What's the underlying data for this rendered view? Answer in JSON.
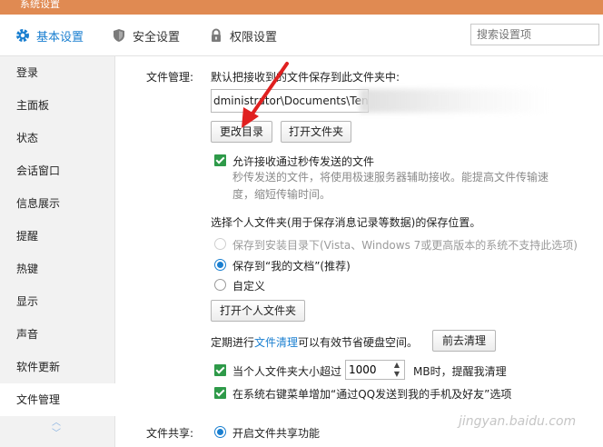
{
  "window": {
    "title": "系统设置"
  },
  "tabs": [
    {
      "label": "基本设置",
      "icon": "gear-icon",
      "active": true
    },
    {
      "label": "安全设置",
      "icon": "shield-icon",
      "active": false
    },
    {
      "label": "权限设置",
      "icon": "lock-icon",
      "active": false
    }
  ],
  "search": {
    "placeholder": "搜索设置项"
  },
  "sidebar": {
    "items": [
      {
        "label": "登录"
      },
      {
        "label": "主面板"
      },
      {
        "label": "状态"
      },
      {
        "label": "会话窗口"
      },
      {
        "label": "信息展示"
      },
      {
        "label": "提醒"
      },
      {
        "label": "热键"
      },
      {
        "label": "显示"
      },
      {
        "label": "声音"
      },
      {
        "label": "软件更新"
      },
      {
        "label": "文件管理",
        "active": true
      }
    ]
  },
  "file_management": {
    "section_label": "文件管理:",
    "save_desc": "默认把接收到的文件保存到此文件夹中:",
    "path_value": "dministrator\\Documents\\Ten",
    "change_dir_button": "更改目录",
    "open_folder_button": "打开文件夹",
    "allow_fast_transfer": {
      "label": "允许接收通过秒传发送的文件",
      "checked": true
    },
    "fast_transfer_hint_line1": "秒传发送的文件，将使用极速服务器辅助接收。能提高文件传输速",
    "fast_transfer_hint_line2": "度，缩短传输时间。",
    "personal_folder_desc": "选择个人文件夹(用于保存消息记录等数据)的保存位置。",
    "radio_options": [
      {
        "label": "保存到安装目录下(Vista、Windows 7或更高版本的系统不支持此选项)",
        "disabled": true,
        "selected": false
      },
      {
        "label": "保存到“我的文档”(推荐)",
        "disabled": false,
        "selected": true
      },
      {
        "label": "自定义",
        "disabled": false,
        "selected": false
      }
    ],
    "open_personal_folder_button": "打开个人文件夹",
    "cleanup_prefix": "定期进行",
    "cleanup_link": "文件清理",
    "cleanup_suffix": "可以有效节省硬盘空间。",
    "go_clean_button": "前去清理",
    "size_limit": {
      "prefix": "当个人文件夹大小超过",
      "value": "1000",
      "suffix": "MB时，提醒我清理",
      "checked": true
    },
    "context_menu": {
      "label": "在系统右键菜单增加“通过QQ发送到我的手机及好友”选项",
      "checked": true
    }
  },
  "file_sharing": {
    "section_label": "文件共享:",
    "enable_label": "开启文件共享功能",
    "selected": true
  },
  "annotation_arrow_color": "#e02020",
  "watermark": "jingyan.baidu.com"
}
